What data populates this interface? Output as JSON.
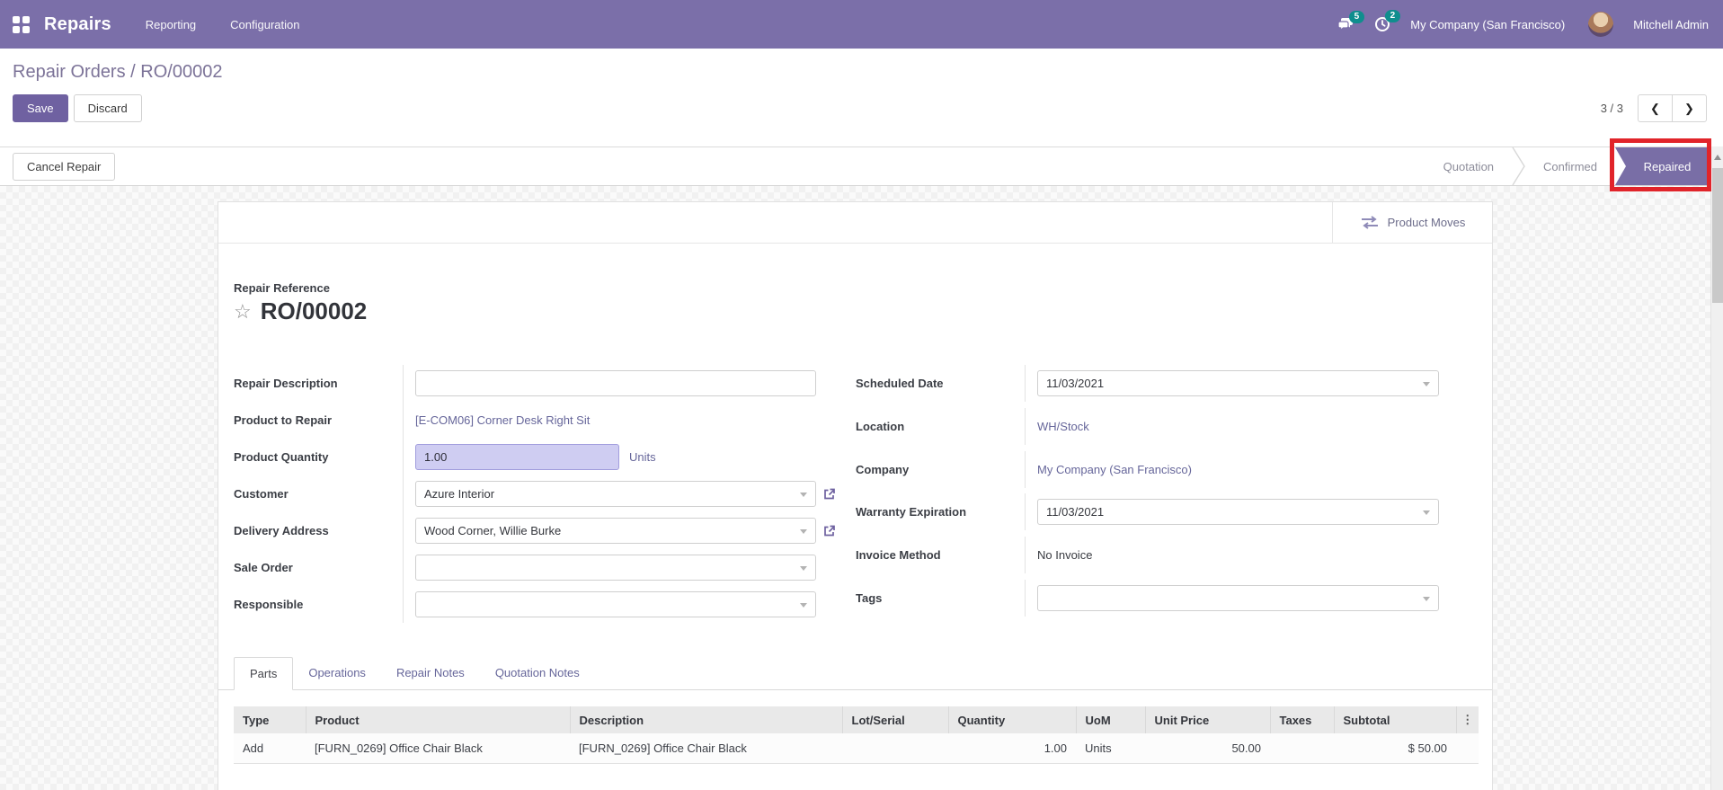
{
  "colors": {
    "topbar_bg": "#7b6fa9",
    "accent_purple": "#6f61a1",
    "active_step_purple": "#796ea6",
    "badge_teal": "#0f8e8e",
    "link_purple": "#66669a",
    "qty_highlight_bg": "#cfcdf2",
    "annotation_red": "#e1242a"
  },
  "topbar": {
    "app_name": "Repairs",
    "menus": [
      "Reporting",
      "Configuration"
    ],
    "messages_count": "5",
    "activities_count": "2",
    "company": "My Company (San Francisco)",
    "user_name": "Mitchell Admin"
  },
  "breadcrumb": {
    "parent": "Repair Orders",
    "separator": " / ",
    "current": "RO/00002"
  },
  "control_panel": {
    "save": "Save",
    "discard": "Discard",
    "pager": "3 / 3",
    "prev": "❮",
    "next": "❯"
  },
  "statusbar": {
    "cancel_button": "Cancel Repair",
    "steps": [
      {
        "label": "Quotation",
        "active": false
      },
      {
        "label": "Confirmed",
        "active": false
      },
      {
        "label": "Repaired",
        "active": true
      }
    ]
  },
  "sheet": {
    "button_box": {
      "product_moves": "Product Moves"
    },
    "title": {
      "label": "Repair Reference",
      "star": "☆",
      "value": "RO/00002"
    },
    "fields": {
      "repair_description": {
        "label": "Repair Description",
        "value": ""
      },
      "product_to_repair": {
        "label": "Product to Repair",
        "value": "[E-COM06] Corner Desk Right Sit"
      },
      "product_quantity": {
        "label": "Product Quantity",
        "value": "1.00",
        "uom": "Units"
      },
      "customer": {
        "label": "Customer",
        "value": "Azure Interior"
      },
      "delivery_address": {
        "label": "Delivery Address",
        "value": "Wood Corner, Willie Burke"
      },
      "sale_order": {
        "label": "Sale Order",
        "value": ""
      },
      "responsible": {
        "label": "Responsible",
        "value": ""
      },
      "scheduled_date": {
        "label": "Scheduled Date",
        "value": "11/03/2021"
      },
      "location": {
        "label": "Location",
        "value": "WH/Stock"
      },
      "company": {
        "label": "Company",
        "value": "My Company (San Francisco)"
      },
      "warranty_expiration": {
        "label": "Warranty Expiration",
        "value": "11/03/2021"
      },
      "invoice_method": {
        "label": "Invoice Method",
        "value": "No Invoice"
      },
      "tags": {
        "label": "Tags",
        "value": ""
      }
    },
    "tabs": [
      {
        "label": "Parts",
        "active": true
      },
      {
        "label": "Operations",
        "active": false
      },
      {
        "label": "Repair Notes",
        "active": false
      },
      {
        "label": "Quotation Notes",
        "active": false
      }
    ],
    "parts_table": {
      "columns": [
        "Type",
        "Product",
        "Description",
        "Lot/Serial",
        "Quantity",
        "UoM",
        "Unit Price",
        "Taxes",
        "Subtotal"
      ],
      "menu_icon": "⋮",
      "row": {
        "type": "Add",
        "product": "[FURN_0269] Office Chair Black",
        "description": "[FURN_0269] Office Chair Black",
        "lot_serial": "",
        "quantity": "1.00",
        "uom": "Units",
        "unit_price": "50.00",
        "taxes": "",
        "subtotal": "$ 50.00"
      }
    }
  }
}
